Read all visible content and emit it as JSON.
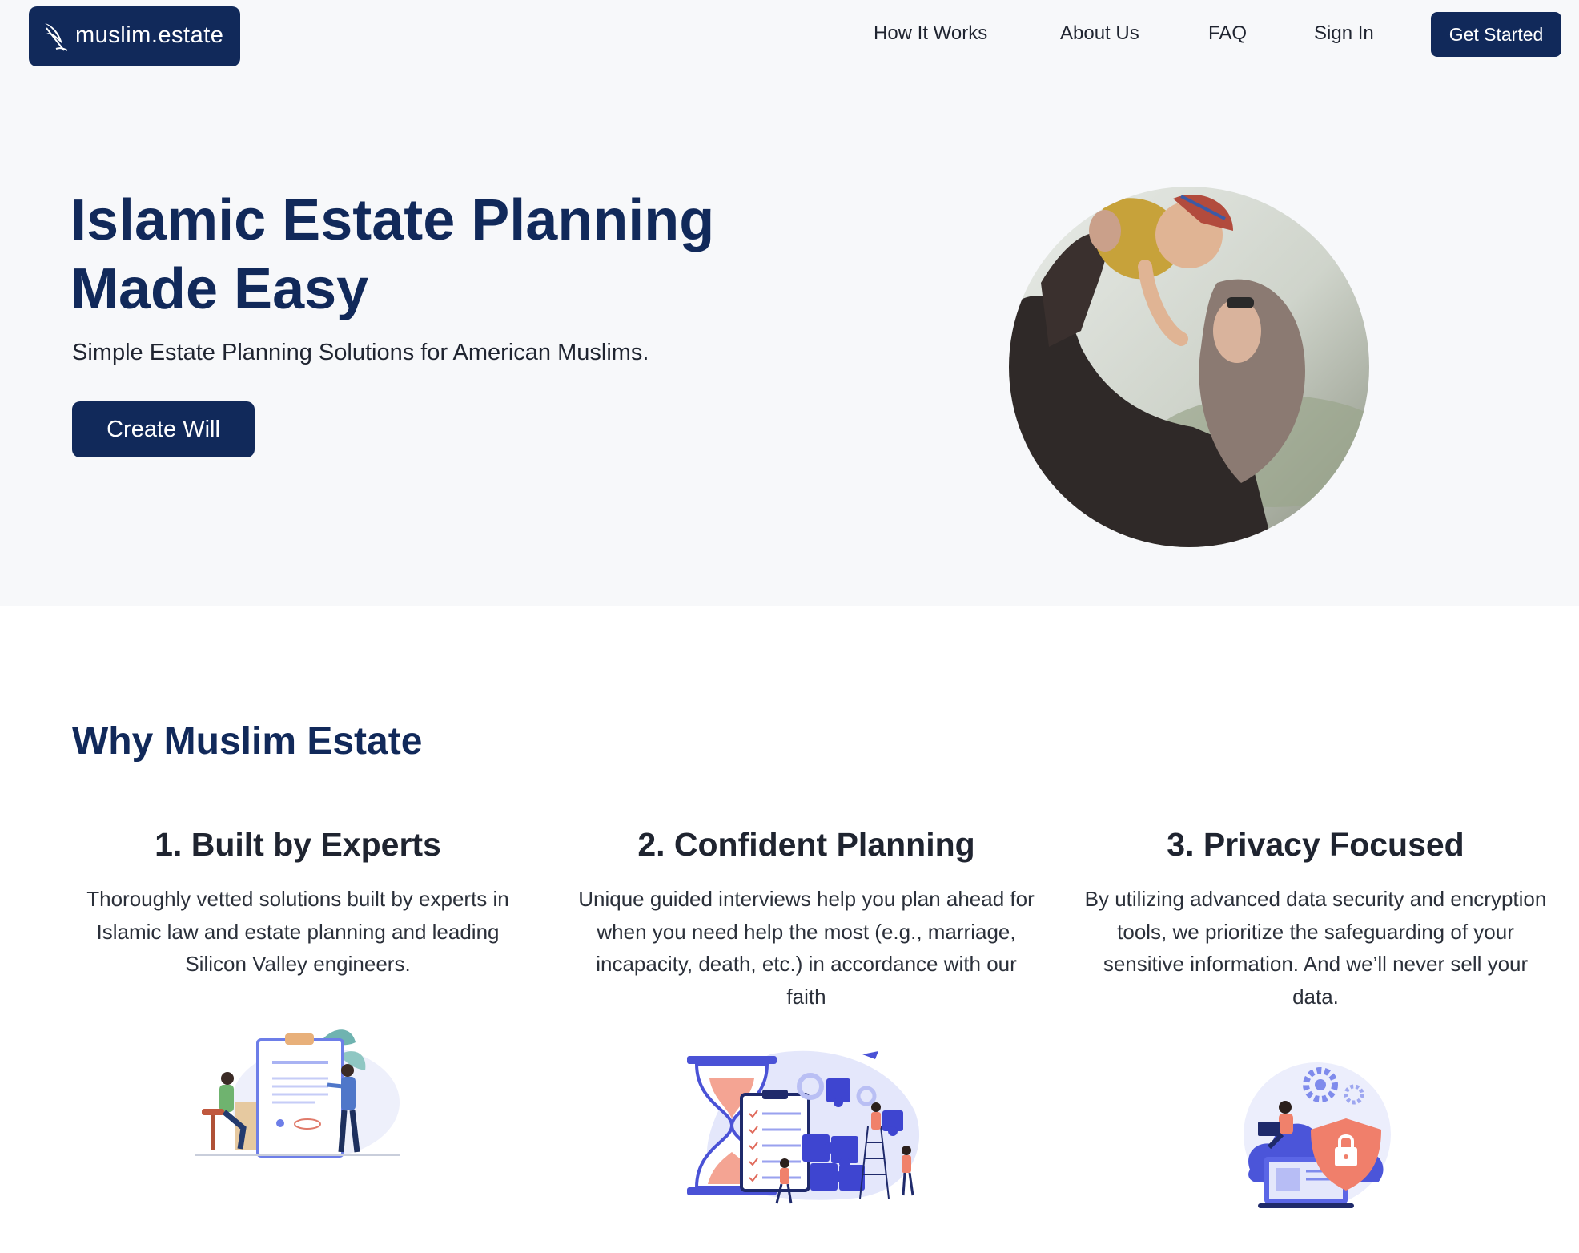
{
  "brand": {
    "name": "muslim.estate",
    "icon": "quill-feather-icon",
    "color": "#11295a"
  },
  "nav": {
    "items": [
      {
        "label": "How It Works"
      },
      {
        "label": "About Us"
      },
      {
        "label": "FAQ"
      },
      {
        "label": "Sign In"
      }
    ],
    "cta_label": "Get Started"
  },
  "hero": {
    "title": "Islamic Estate Planning Made Easy",
    "subtitle": "Simple Estate Planning Solutions for American Muslims.",
    "button_label": "Create Will",
    "photo": "mother-lifting-baby-photo"
  },
  "why": {
    "title": "Why Muslim Estate",
    "features": [
      {
        "title": "1. Built by Experts",
        "text": "Thoroughly vetted solutions built by experts in Islamic law and estate planning and leading Silicon Valley engineers.",
        "illustration": "document-signing-illustration"
      },
      {
        "title": "2. Confident Planning",
        "text": "Unique guided interviews help you plan ahead for when you need help the most (e.g., marriage, incapacity, death, etc.) in accordance with our faith",
        "illustration": "hourglass-puzzle-illustration"
      },
      {
        "title": "3. Privacy Focused",
        "text": "By utilizing advanced data security and encryption tools, we prioritize the safeguarding of your sensitive information. And we’ll never sell your data.",
        "illustration": "security-shield-illustration"
      }
    ]
  },
  "colors": {
    "primary": "#11295a",
    "hero_background": "#f7f8fa",
    "illustration_blue": "#5b63e6",
    "illustration_coral": "#f0816b"
  }
}
